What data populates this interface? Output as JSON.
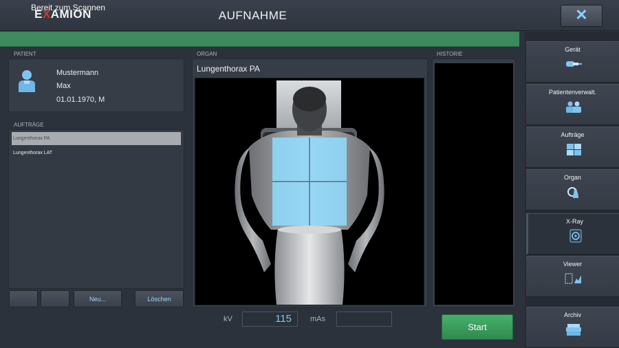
{
  "header": {
    "logo_prefix": "E",
    "logo_x": "X",
    "logo_suffix": "AMION",
    "title": "AUFNAHME",
    "close_label": "✕"
  },
  "status": {
    "text": "Bereit zum Scannen",
    "color": "#3c8a5d"
  },
  "patient": {
    "section_label": "PATIENT",
    "last_name": "Mustermann",
    "first_name": "Max",
    "dob_sex": "01.01.1970, M"
  },
  "orders": {
    "section_label": "AUFTRÄGE",
    "items": [
      "Lungenthorax PA",
      "Lungenthorax LAT"
    ],
    "selected_index": 0
  },
  "buttons": {
    "new_label": "Neu...",
    "delete_label": "Löschen"
  },
  "organ": {
    "section_label": "ORGAN",
    "title": "Lungenthorax PA"
  },
  "history": {
    "section_label": "HISTORIE"
  },
  "exposure": {
    "kv_label": "kV",
    "kv_value": "115",
    "mas_label": "mAs",
    "mas_value": ""
  },
  "start": {
    "label": "Start",
    "color": "#3fa563"
  },
  "nav": {
    "items": [
      {
        "label": "Gerät",
        "icon": "device-icon"
      },
      {
        "label": "Patientenverwalt.",
        "icon": "patients-icon"
      },
      {
        "label": "Aufträge",
        "icon": "orders-icon"
      },
      {
        "label": "Organ",
        "icon": "organ-icon"
      },
      {
        "label": "X-Ray",
        "icon": "xray-icon"
      },
      {
        "label": "Viewer",
        "icon": "viewer-icon"
      },
      {
        "label": "Archiv",
        "icon": "archive-icon"
      }
    ],
    "active_index": 4
  },
  "colors": {
    "accent": "#8fd0ff",
    "background": "#2c323c"
  }
}
